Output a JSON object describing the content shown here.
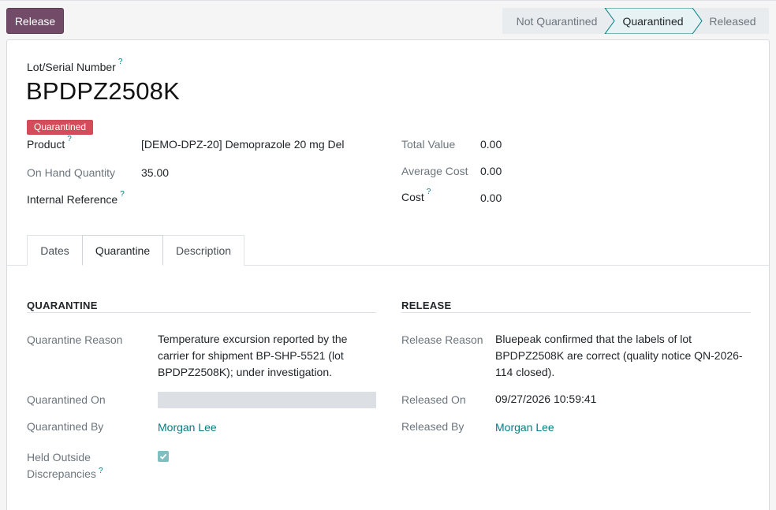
{
  "toolbar": {
    "release_label": "Release"
  },
  "statusbar": {
    "steps": [
      "Not Quarantined",
      "Quarantined",
      "Released"
    ],
    "active": "Quarantined"
  },
  "record": {
    "lot_label": "Lot/Serial Number",
    "help_mark": "?",
    "lot_number": "BPDPZ2508K",
    "status_badge": "Quarantined",
    "product_label": "Product",
    "product_value": "[DEMO-DPZ-20] Demoprazole 20 mg Del",
    "on_hand_label": "On Hand Quantity",
    "on_hand_value": "35.00",
    "internal_ref_label": "Internal Reference",
    "total_value_label": "Total Value",
    "total_value": "0.00",
    "avg_cost_label": "Average Cost",
    "avg_cost_value": "0.00",
    "cost_label": "Cost",
    "cost_value": "0.00"
  },
  "tabs": [
    {
      "label": "Dates"
    },
    {
      "label": "Quarantine"
    },
    {
      "label": "Description"
    }
  ],
  "active_tab": "Quarantine",
  "quarantine": {
    "title": "QUARANTINE",
    "reason_label": "Quarantine Reason",
    "reason_lines": [
      "Temperature excursion reported by the",
      "carrier for shipment BP-SHP-5521 (lot",
      "BPDPZ2508K); under investigation."
    ],
    "on_label": "Quarantined On",
    "on_value": "",
    "by_label": "Quarantined By",
    "by_value": "Morgan Lee",
    "held_label_1": "Held Outside",
    "held_label_2": "Discrepancies",
    "held_checked": true
  },
  "release": {
    "title": "RELEASE",
    "reason_label": "Release Reason",
    "reason_lines": [
      "Bluepeak confirmed that the labels of lot",
      "BPDPZ2508K are correct (quality notice QN-2026-",
      "114 closed)."
    ],
    "on_label": "Released On",
    "on_value": "09/27/2026 10:59:41",
    "by_label": "Released By",
    "by_value": "Morgan Lee"
  },
  "colors": {
    "primary": "#714b67",
    "badge_danger": "#d44c59",
    "link": "#017e84",
    "check": "#7fbfbf"
  }
}
